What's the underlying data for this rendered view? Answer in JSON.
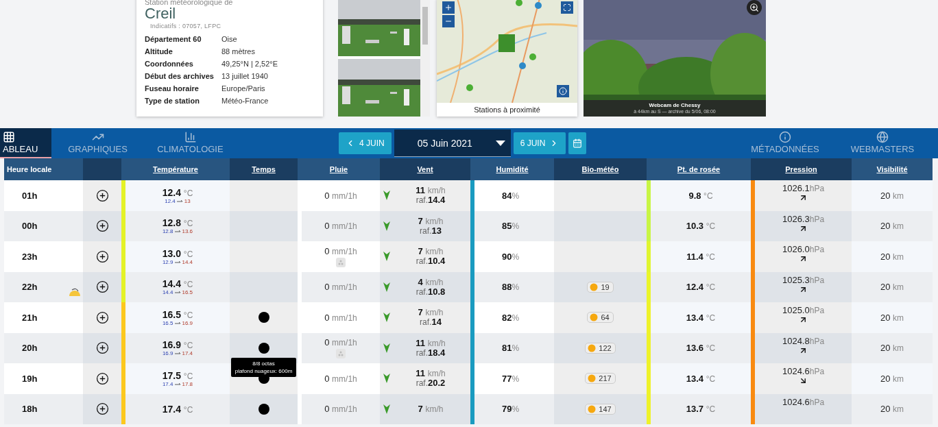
{
  "station": {
    "subtitle": "Station météorologique de",
    "name": "Creil",
    "codes": "Indicatifs : 07057, LFPC",
    "details": [
      {
        "label": "Département 60",
        "value": "Oise"
      },
      {
        "label": "Altitude",
        "value": "88 mètres"
      },
      {
        "label": "Coordonnées",
        "value": "49,25°N | 2,52°E"
      },
      {
        "label": "Début des archives",
        "value": "13 juillet 1940"
      },
      {
        "label": "Fuseau horaire",
        "value": "Europe/Paris"
      },
      {
        "label": "Type de station",
        "value": "Météo-France"
      }
    ]
  },
  "map": {
    "caption": "Stations à proximité"
  },
  "webcam": {
    "title": "Webcam de Chessy",
    "subtitle": "à 44km au S — archive du 5/06, 08:00"
  },
  "tabs_left": [
    {
      "label": "ABLEAU",
      "selected": true
    },
    {
      "label": "GRAPHIQUES",
      "selected": false
    },
    {
      "label": "CLIMATOLOGIE",
      "selected": false
    }
  ],
  "date_nav": {
    "previous": "4 JUIN",
    "current": "05 Juin 2021",
    "next": "6 JUIN"
  },
  "tabs_right": [
    {
      "label": "MÉTADONNÉES",
      "selected": false
    },
    {
      "label": "WEBMASTERS",
      "selected": false
    }
  ],
  "table": {
    "columns": [
      "Heure locale",
      "Température",
      "Temps",
      "Pluie",
      "Vent",
      "Humidité",
      "Bio-météo",
      "Pt. de rosée",
      "Pression",
      "Visibilité"
    ],
    "rows": [
      {
        "time": "01h",
        "sunset": false,
        "temperature": {
          "value": "12.4",
          "unit": "°C",
          "low": "12.4",
          "high": "13",
          "color": "#e4f227"
        },
        "cloud": false,
        "rain": {
          "value": "0",
          "unit": "mm/1h",
          "icon": false
        },
        "wind": {
          "speed": "11",
          "unit": "km/h",
          "gust_label": "raf.",
          "gust": "14.4"
        },
        "humidity": {
          "value": "84",
          "unit": "%"
        },
        "uv": null,
        "dew": {
          "value": "9.8",
          "unit": "°C",
          "color": "#c8f545"
        },
        "pressure": {
          "value": "1026.1",
          "unit": "hPa",
          "rising": true
        },
        "visibility": {
          "value": "20",
          "unit": "km"
        }
      },
      {
        "time": "00h",
        "sunset": false,
        "temperature": {
          "value": "12.8",
          "unit": "°C",
          "low": "12.8",
          "high": "13.6",
          "color": "#e4f227"
        },
        "cloud": false,
        "rain": {
          "value": "0",
          "unit": "mm/1h",
          "icon": false
        },
        "wind": {
          "speed": "7",
          "unit": "km/h",
          "gust_label": "raf.",
          "gust": "13"
        },
        "humidity": {
          "value": "85",
          "unit": "%"
        },
        "uv": null,
        "dew": {
          "value": "10.3",
          "unit": "°C",
          "color": "#c8f545"
        },
        "pressure": {
          "value": "1026.3",
          "unit": "hPa",
          "rising": true
        },
        "visibility": {
          "value": "20",
          "unit": "km"
        }
      },
      {
        "time": "23h",
        "sunset": false,
        "temperature": {
          "value": "13.0",
          "unit": "°C",
          "low": "12.9",
          "high": "14.4",
          "color": "#e4f227"
        },
        "cloud": false,
        "rain": {
          "value": "0",
          "unit": "mm/1h",
          "icon": true
        },
        "wind": {
          "speed": "7",
          "unit": "km/h",
          "gust_label": "raf.",
          "gust": "10.4"
        },
        "humidity": {
          "value": "90",
          "unit": "%"
        },
        "uv": null,
        "dew": {
          "value": "11.4",
          "unit": "°C",
          "color": "#e0f530"
        },
        "pressure": {
          "value": "1026.0",
          "unit": "hPa",
          "rising": true
        },
        "visibility": {
          "value": "20",
          "unit": "km"
        }
      },
      {
        "time": "22h",
        "sunset": true,
        "temperature": {
          "value": "14.4",
          "unit": "°C",
          "low": "14.4",
          "high": "16.5",
          "color": "#e4f227"
        },
        "cloud": false,
        "rain": {
          "value": "0",
          "unit": "mm/1h",
          "icon": false
        },
        "wind": {
          "speed": "4",
          "unit": "km/h",
          "gust_label": "raf.",
          "gust": "10.8"
        },
        "humidity": {
          "value": "88",
          "unit": "%"
        },
        "uv": "19",
        "dew": {
          "value": "12.4",
          "unit": "°C",
          "color": "#eaf52a"
        },
        "pressure": {
          "value": "1025.3",
          "unit": "hPa",
          "rising": true
        },
        "visibility": {
          "value": "20",
          "unit": "km"
        }
      },
      {
        "time": "21h",
        "sunset": false,
        "temperature": {
          "value": "16.5",
          "unit": "°C",
          "low": "16.5",
          "high": "16.9",
          "color": "#fcc81e"
        },
        "cloud": true,
        "rain": {
          "value": "0",
          "unit": "mm/1h",
          "icon": false
        },
        "wind": {
          "speed": "7",
          "unit": "km/h",
          "gust_label": "raf.",
          "gust": "14"
        },
        "humidity": {
          "value": "82",
          "unit": "%"
        },
        "uv": "64",
        "dew": {
          "value": "13.4",
          "unit": "°C",
          "color": "#eef22a"
        },
        "pressure": {
          "value": "1025.0",
          "unit": "hPa",
          "rising": true
        },
        "visibility": {
          "value": "20",
          "unit": "km"
        }
      },
      {
        "time": "20h",
        "sunset": false,
        "temperature": {
          "value": "16.9",
          "unit": "°C",
          "low": "16.9",
          "high": "17.4",
          "color": "#fcc81e"
        },
        "cloud": true,
        "tooltip": [
          "8/8 octas",
          "plafond nuageux: 600m"
        ],
        "rain": {
          "value": "0",
          "unit": "mm/1h",
          "icon": true
        },
        "wind": {
          "speed": "11",
          "unit": "km/h",
          "gust_label": "raf.",
          "gust": "18.4"
        },
        "humidity": {
          "value": "81",
          "unit": "%"
        },
        "uv": "122",
        "dew": {
          "value": "13.6",
          "unit": "°C",
          "color": "#eef22a"
        },
        "pressure": {
          "value": "1024.8",
          "unit": "hPa",
          "rising": true
        },
        "visibility": {
          "value": "20",
          "unit": "km"
        }
      },
      {
        "time": "19h",
        "sunset": false,
        "temperature": {
          "value": "17.5",
          "unit": "°C",
          "low": "17.4",
          "high": "17.8",
          "color": "#fcc81e"
        },
        "cloud": true,
        "rain": {
          "value": "0",
          "unit": "mm/1h",
          "icon": false
        },
        "wind": {
          "speed": "11",
          "unit": "km/h",
          "gust_label": "raf.",
          "gust": "20.2"
        },
        "humidity": {
          "value": "77",
          "unit": "%"
        },
        "uv": "217",
        "dew": {
          "value": "13.4",
          "unit": "°C",
          "color": "#eef22a"
        },
        "pressure": {
          "value": "1024.6",
          "unit": "hPa",
          "rising": false
        },
        "visibility": {
          "value": "20",
          "unit": "km"
        }
      },
      {
        "time": "18h",
        "sunset": false,
        "temperature": {
          "value": "17.4",
          "unit": "°C",
          "color": "#fcc81e"
        },
        "cloud": true,
        "rain": {
          "value": "0",
          "unit": "mm/1h",
          "icon": false
        },
        "wind": {
          "speed": "7",
          "unit": "km/h"
        },
        "humidity": {
          "value": "79",
          "unit": "%"
        },
        "uv": "147",
        "dew": {
          "value": "13.7",
          "unit": "°C",
          "color": "#eef22a"
        },
        "pressure": {
          "value": "1024.6",
          "unit": "hPa"
        },
        "visibility": {
          "value": "20",
          "unit": "km"
        }
      }
    ]
  }
}
